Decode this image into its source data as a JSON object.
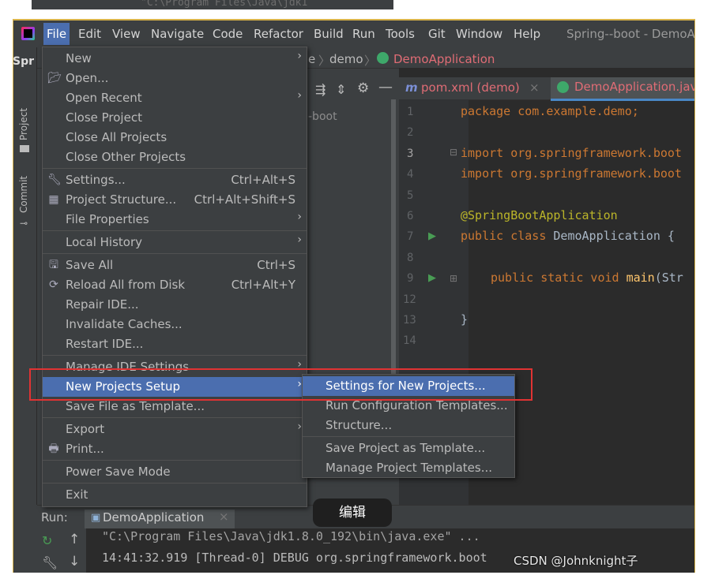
{
  "top_strip_text": "\"C:\\Program Files\\Java\\jdk1",
  "menubar": {
    "items": [
      "File",
      "Edit",
      "View",
      "Navigate",
      "Code",
      "Refactor",
      "Build",
      "Run",
      "Tools",
      "Git",
      "Window",
      "Help"
    ],
    "project_title": "Spring--boot - DemoA"
  },
  "left_strip": {
    "project_tab": "Project",
    "commit_tab": "Commit",
    "project_label_partial": "Spr"
  },
  "breadcrumbs": {
    "part1": "e",
    "part2": "demo",
    "part3": "DemoApplication"
  },
  "tabs": {
    "pom": "pom.xml (demo)",
    "demo_app": "DemoApplication.java"
  },
  "project_tree": {
    "item": "-boot"
  },
  "editor": {
    "line_numbers": [
      "1",
      "2",
      "3",
      "4",
      "5",
      "6",
      "7",
      "8",
      "9",
      "12",
      "13",
      "14"
    ],
    "lines": {
      "l1": "package com.example.demo;",
      "l3": "import org.springframework.boot",
      "l4": "import org.springframework.boot",
      "l6": "@SpringBootApplication",
      "l7a": "public class ",
      "l7b": "DemoApplication {",
      "l9a": "public static void ",
      "l9b": "main",
      "l9c": "(Str",
      "l13": "}"
    }
  },
  "file_menu": {
    "new": "New",
    "open": "Open...",
    "open_recent": "Open Recent",
    "close_project": "Close Project",
    "close_all": "Close All Projects",
    "close_other": "Close Other Projects",
    "settings": "Settings...",
    "settings_sc": "Ctrl+Alt+S",
    "project_structure": "Project Structure...",
    "project_structure_sc": "Ctrl+Alt+Shift+S",
    "file_properties": "File Properties",
    "local_history": "Local History",
    "save_all": "Save All",
    "save_all_sc": "Ctrl+S",
    "reload": "Reload All from Disk",
    "reload_sc": "Ctrl+Alt+Y",
    "repair": "Repair IDE...",
    "invalidate": "Invalidate Caches...",
    "restart": "Restart IDE...",
    "manage_ide": "Manage IDE Settings",
    "new_projects_setup": "New Projects Setup",
    "save_template": "Save File as Template...",
    "export": "Export",
    "print": "Print...",
    "power_save": "Power Save Mode",
    "exit": "Exit"
  },
  "submenu": {
    "settings_new": "Settings for New Projects...",
    "run_config": "Run Configuration Templates...",
    "structure": "Structure...",
    "save_project_template": "Save Project as Template...",
    "manage_templates": "Manage Project Templates..."
  },
  "run_panel": {
    "label": "Run:",
    "tab": "DemoApplication",
    "line1": "\"C:\\Program Files\\Java\\jdk1.8.0_192\\bin\\java.exe\" ...",
    "line2": "14:41:32.919 [Thread-0] DEBUG org.springframework.boot"
  },
  "tooltip": "编辑",
  "watermark": "CSDN @Johnknight子"
}
